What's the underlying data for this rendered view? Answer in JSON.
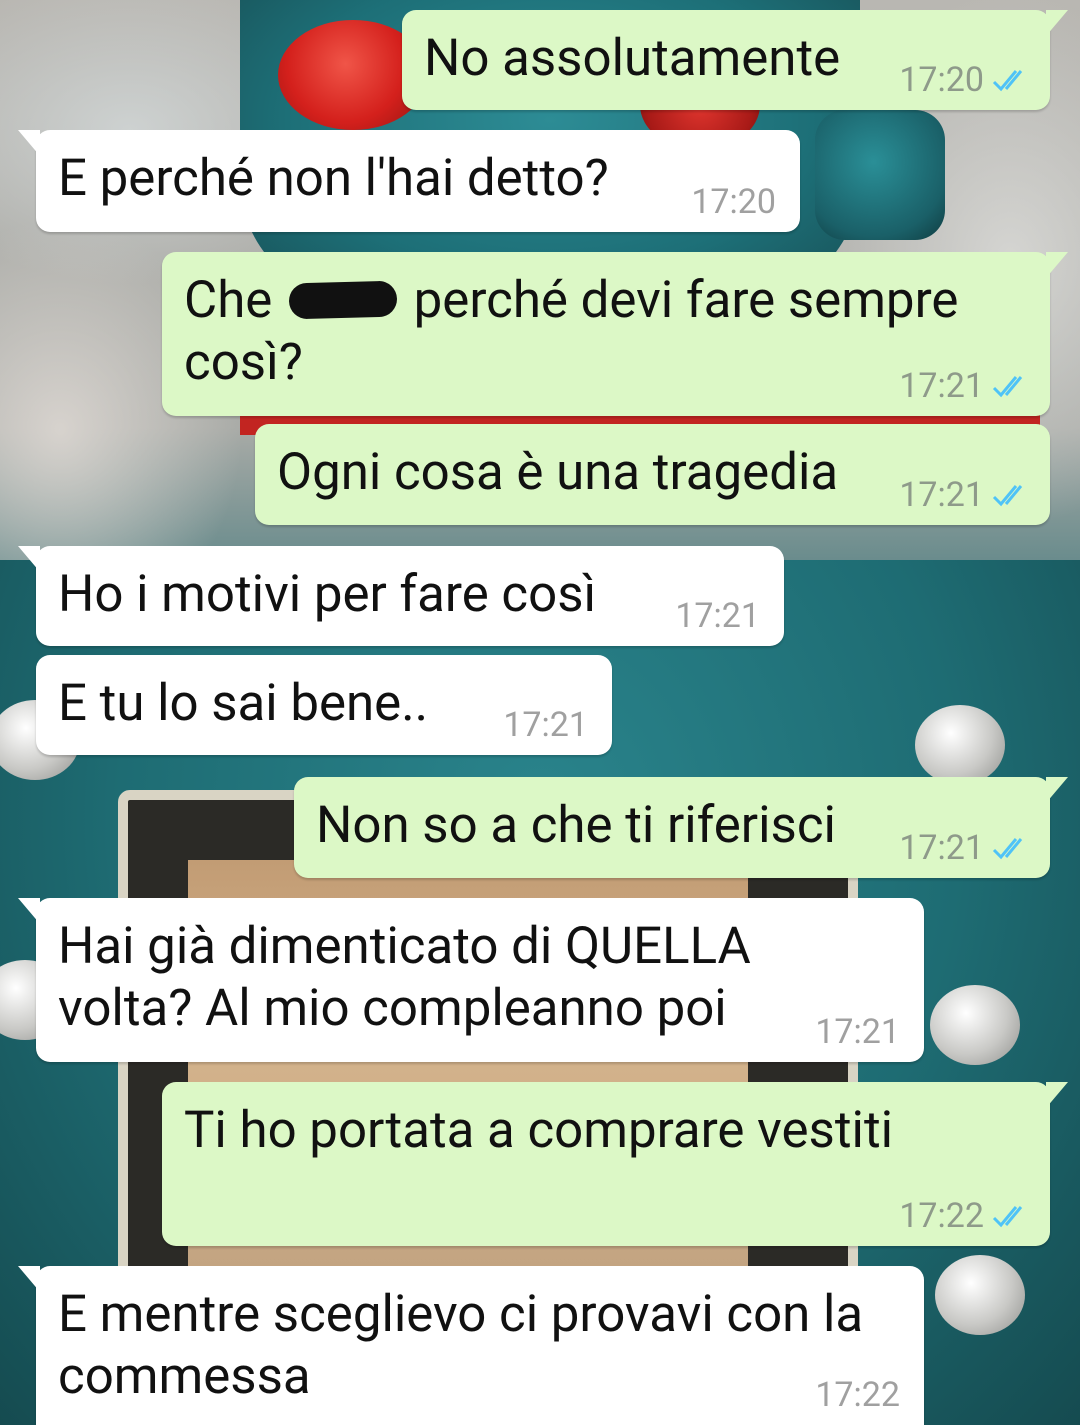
{
  "messages": [
    {
      "dir": "out",
      "text": "No assolutamente",
      "time": "17:20",
      "status": "read"
    },
    {
      "dir": "in",
      "text": "E perché non l'hai detto?",
      "time": "17:20"
    },
    {
      "dir": "out",
      "text_before": "Che",
      "text_after": "perché devi fare sempre",
      "text_line2": "così?",
      "censored": true,
      "time": "17:21",
      "status": "read"
    },
    {
      "dir": "out",
      "text": "Ogni cosa è una tragedia",
      "time": "17:21",
      "status": "read"
    },
    {
      "dir": "in",
      "text": "Ho i motivi per fare così",
      "time": "17:21"
    },
    {
      "dir": "in",
      "text": "E tu lo sai bene..",
      "time": "17:21"
    },
    {
      "dir": "out",
      "text": "Non so a che ti riferisci",
      "time": "17:21",
      "status": "read"
    },
    {
      "dir": "in",
      "text": "Hai già dimenticato di QUELLA\nvolta? Al mio compleanno poi",
      "time": "17:21"
    },
    {
      "dir": "out",
      "text": "Ti ho portata a comprare vestiti",
      "time": "17:22",
      "status": "read"
    },
    {
      "dir": "in",
      "text": "E mentre sceglievo ci provavi con la\ncommessa",
      "time": "17:22"
    }
  ],
  "colors": {
    "outgoing_bubble": "#dcf8c6",
    "incoming_bubble": "#ffffff",
    "read_ticks": "#4fc3f7",
    "timestamp": "#8e9a8a"
  },
  "icons": {
    "read_receipt": "double-check-icon"
  }
}
